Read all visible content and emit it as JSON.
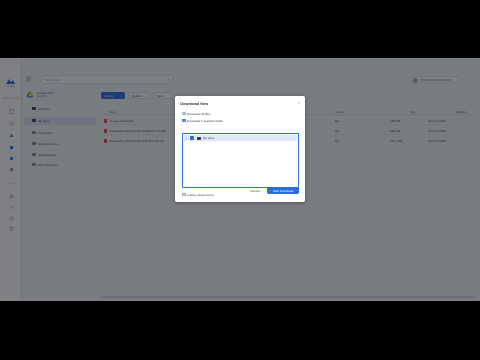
{
  "rail": {
    "logo_text": "CloudHQ",
    "section1": "BACKUP & SYNC",
    "section2": "TOOLS"
  },
  "topbar": {
    "search_placeholder": "Search files"
  },
  "sidebar": {
    "account_name": "Google drive",
    "account_sub": "Account",
    "items": [
      {
        "label": "All items"
      },
      {
        "label": "My drive"
      },
      {
        "label": "Computers"
      },
      {
        "label": "Shared with me"
      },
      {
        "label": "Shared drives"
      },
      {
        "label": "My Computers"
      }
    ]
  },
  "toolbar": {
    "primary": "Upload",
    "btn2": "Upload",
    "btn3": "New"
  },
  "table": {
    "headers": {
      "name": "Name",
      "owner": "Owner",
      "size": "Size",
      "modified": "Modified"
    },
    "rows": [
      {
        "name": "my-test-report.pdf",
        "owner": "Me",
        "size": "182 KB",
        "modified": "Nov 14, 2023"
      },
      {
        "name": "Screenshot 2023-11-08 at 2023-11 hrs.pdf",
        "owner": "Me",
        "size": "236 KB",
        "modified": "Nov 13, 2023"
      },
      {
        "name": "Screenshot 2023-11-08 at 11:05 2 hrs.pdf",
        "owner": "Me",
        "size": "211.7 KB",
        "modified": "Nov 13, 2023"
      }
    ]
  },
  "dialog": {
    "title": "Download files",
    "option_all": "Download all files",
    "option_selected": "Download 1 selected folder",
    "tree_item": "My drive",
    "archive_label": "Archive deleted items",
    "cancel": "Cancel",
    "start": "Start Download"
  },
  "colors": {
    "accent": "#2d6cdf",
    "pdf": "#e2403a"
  }
}
